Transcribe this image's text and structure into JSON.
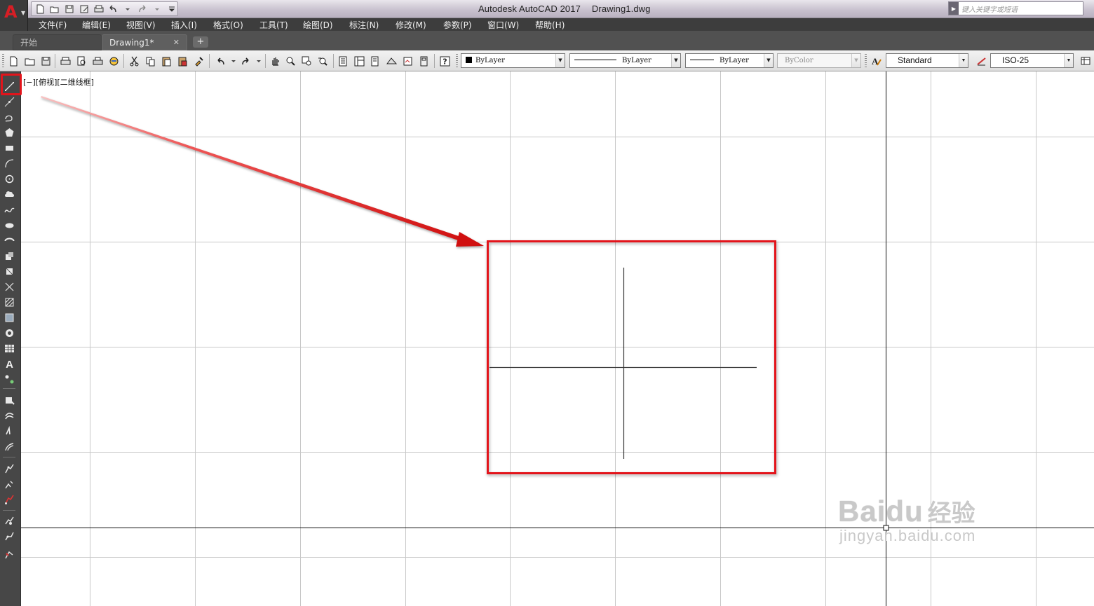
{
  "app": {
    "title": "Autodesk AutoCAD 2017",
    "filename": "Drawing1.dwg",
    "logo_letter": "A",
    "search_placeholder": "键入关键字或短语"
  },
  "menu": [
    "文件(F)",
    "编辑(E)",
    "视图(V)",
    "插入(I)",
    "格式(O)",
    "工具(T)",
    "绘图(D)",
    "标注(N)",
    "修改(M)",
    "参数(P)",
    "窗口(W)",
    "帮助(H)"
  ],
  "tabs": {
    "start": "开始",
    "drawing": "Drawing1*",
    "close": "✕",
    "add": "+"
  },
  "toolbar": {
    "color": "ByLayer",
    "linetype": "ByLayer",
    "lineweight": "ByLayer",
    "plotstyle": "ByColor",
    "textstyle": "Standard",
    "dimstyle": "ISO-25"
  },
  "viewport_label": "[−][俯视][二维线框]",
  "watermark": {
    "brand": "Baidu",
    "cn": "经验",
    "site": "jingyan.baidu.com"
  },
  "colors": {
    "highlight": "#e3141b",
    "menubar": "#3d3d3d",
    "drawbar": "#474747",
    "grid": "#c8c8c8"
  }
}
